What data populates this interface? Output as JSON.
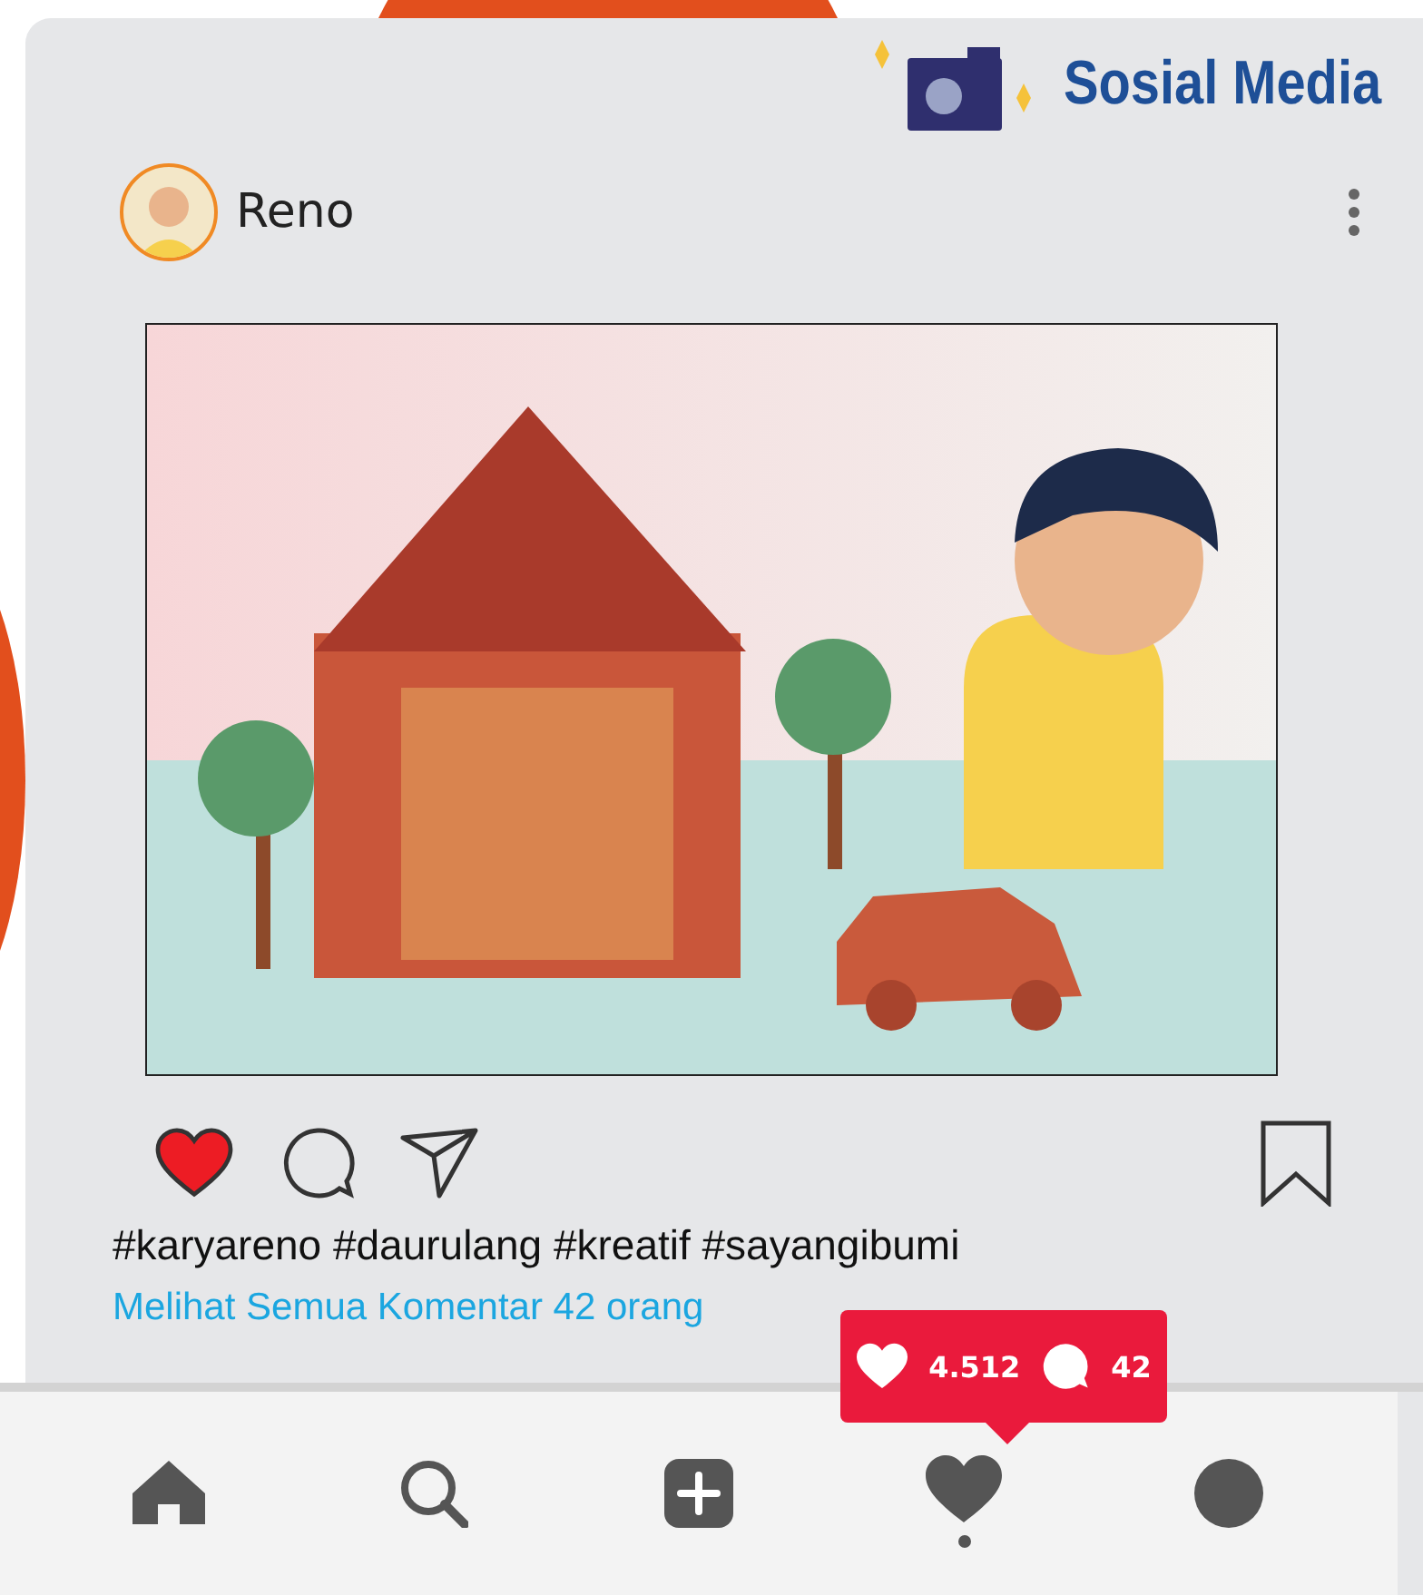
{
  "header": {
    "logo_text": "Sosial Media"
  },
  "post": {
    "user": {
      "name": "Reno"
    },
    "liked": true,
    "saved": false,
    "caption": "#karyareno #daurulang #kreatif #sayangibumi",
    "comments_link": "Melihat Semua Komentar 42 orang"
  },
  "notification": {
    "likes": "4.512",
    "comments": "42"
  },
  "nav": [
    {
      "kind": "home",
      "selected": false
    },
    {
      "kind": "search",
      "selected": false
    },
    {
      "kind": "add",
      "selected": false
    },
    {
      "kind": "activity",
      "selected": true
    },
    {
      "kind": "profile",
      "selected": false
    }
  ]
}
